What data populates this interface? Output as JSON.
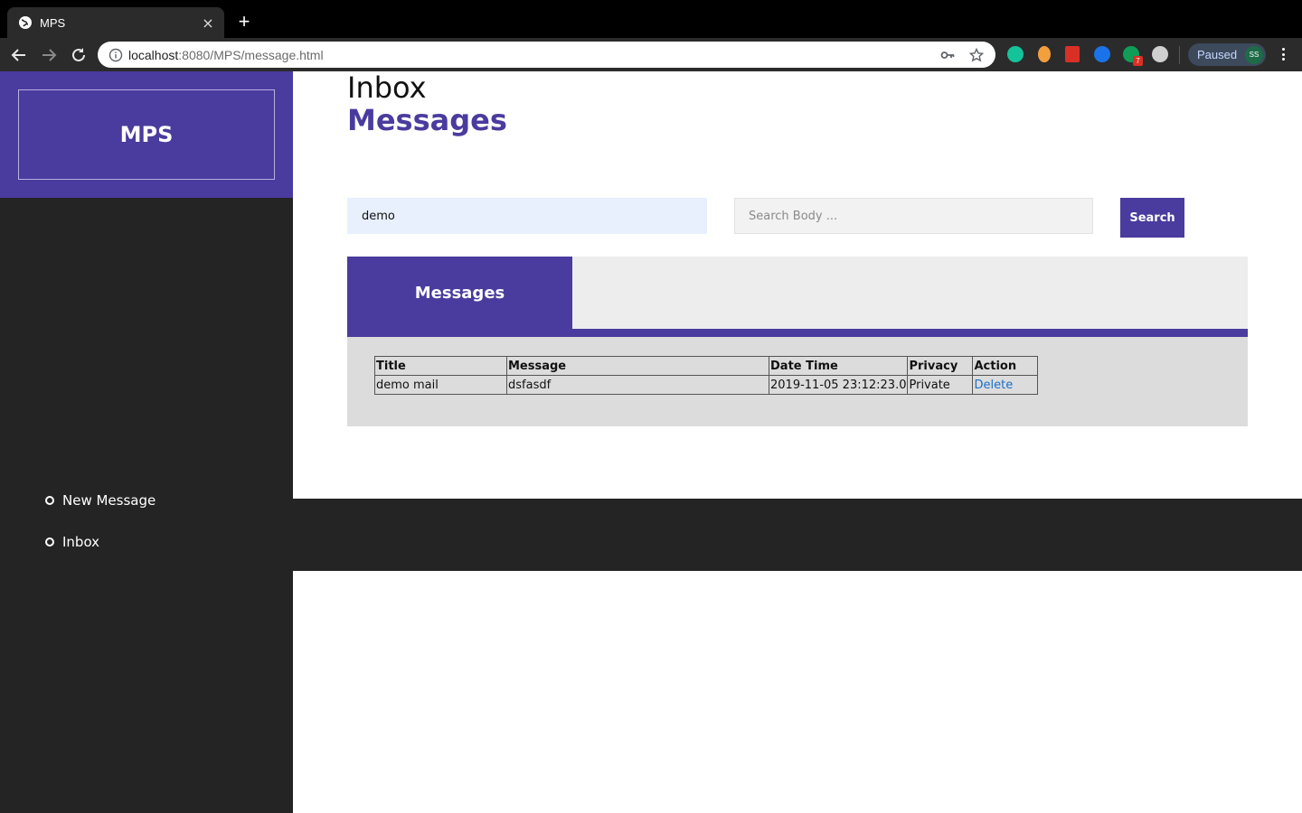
{
  "browser": {
    "tab_title": "MPS",
    "tab_close": "×",
    "new_tab": "+",
    "url_host": "localhost",
    "url_path": ":8080/MPS/message.html",
    "profile_status": "Paused",
    "profile_initials": "SS",
    "extension_badge": "7"
  },
  "sidebar": {
    "brand": "MPS",
    "items": [
      {
        "label": "New Message"
      },
      {
        "label": "Inbox"
      }
    ]
  },
  "header": {
    "line1": "Inbox",
    "line2": "Messages"
  },
  "search": {
    "title_value": "demo",
    "body_placeholder": "Search Body ...",
    "button_label": "Search"
  },
  "panel": {
    "tab_label": "Messages",
    "columns": [
      "Title",
      "Message",
      "Date Time",
      "Privacy",
      "Action"
    ],
    "rows": [
      {
        "title": "demo mail",
        "message": "dsfasdf",
        "datetime": "2019-11-05 23:12:23.0",
        "privacy": "Private",
        "action": "Delete"
      }
    ]
  },
  "colors": {
    "brand": "#4a3b9e",
    "sidebar_bg": "#242424",
    "link": "#1a6fc9"
  }
}
